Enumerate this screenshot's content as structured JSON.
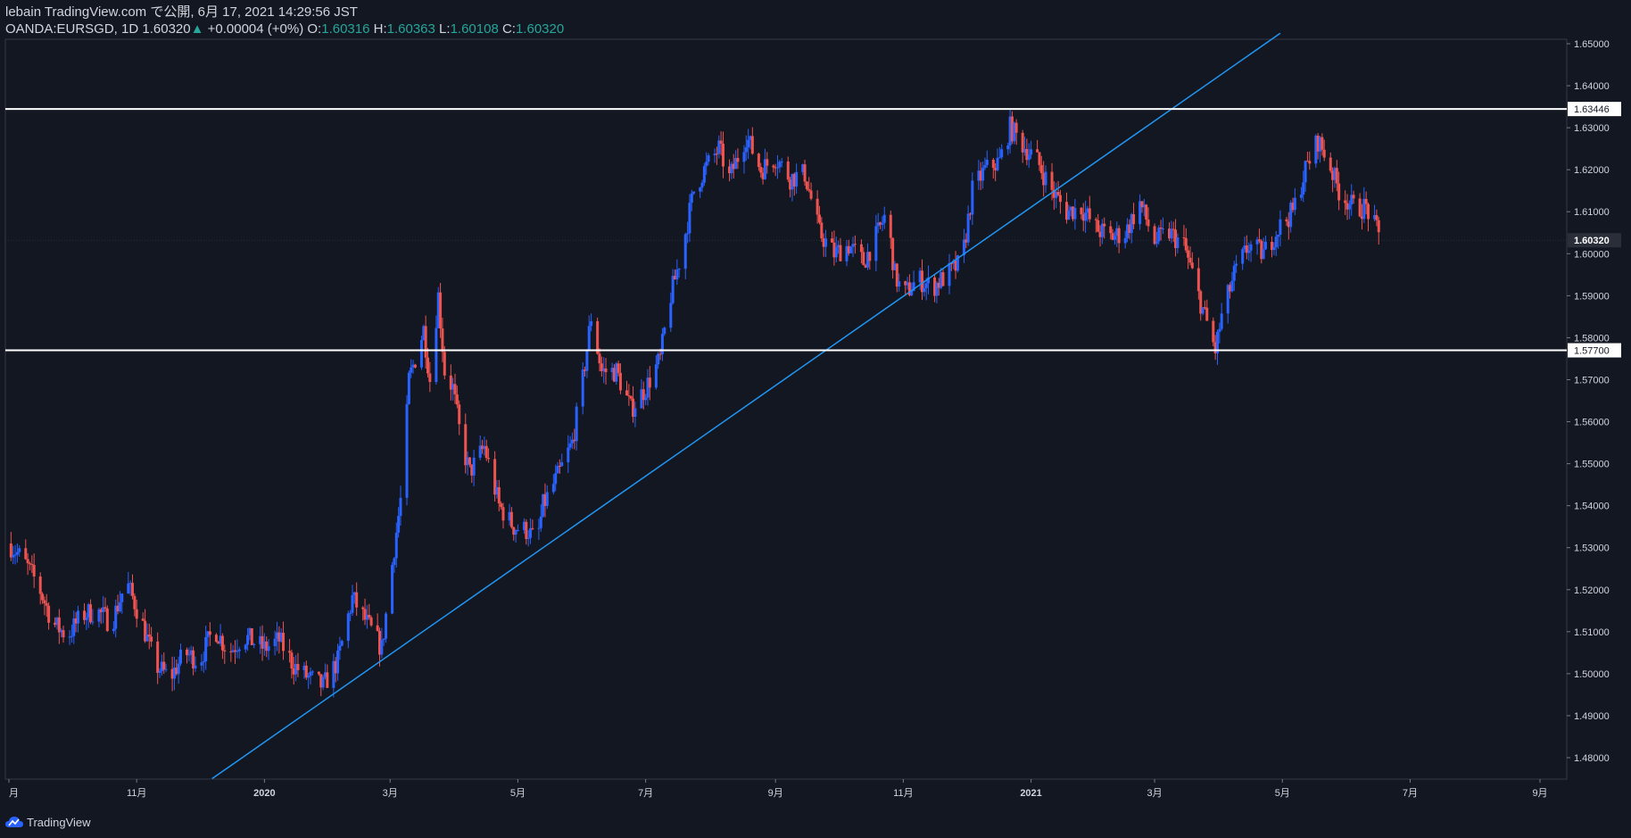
{
  "header": {
    "publish_line": "lebain TradingView.com で公開, 6月 17, 2021 14:29:56 JST",
    "symbol": "OANDA:EURSGD, 1D",
    "last": "1.60320",
    "change_arrow": "▲",
    "change": "+0.00004 (+0%)",
    "open_label": "O:",
    "open": "1.60316",
    "high_label": "H:",
    "high": "1.60363",
    "low_label": "L:",
    "low": "1.60108",
    "close_label": "C:",
    "close": "1.60320"
  },
  "footer": {
    "brand": "TradingView"
  },
  "colors": {
    "background": "#131722",
    "up": "#2962ff",
    "down": "#ef5350",
    "trendline": "#2196f3",
    "level": "#ffffff",
    "axis_text": "#d1d4dc",
    "teal": "#26a69a"
  },
  "chart_data": {
    "type": "candlestick",
    "symbol": "OANDA:EURSGD",
    "interval": "1D",
    "ylim": [
      1.475,
      1.6525
    ],
    "y_ticks": [
      "1.48000",
      "1.49000",
      "1.50000",
      "1.51000",
      "1.52000",
      "1.53000",
      "1.54000",
      "1.55000",
      "1.56000",
      "1.57000",
      "1.58000",
      "1.59000",
      "1.60000",
      "1.61000",
      "1.62000",
      "1.63000",
      "1.64000",
      "1.65000"
    ],
    "x_ticks": [
      {
        "label": "月",
        "date": "2019-09-01"
      },
      {
        "label": "11月",
        "date": "2019-11-01"
      },
      {
        "label": "2020",
        "date": "2020-01-01"
      },
      {
        "label": "3月",
        "date": "2020-03-01"
      },
      {
        "label": "5月",
        "date": "2020-05-01"
      },
      {
        "label": "7月",
        "date": "2020-07-01"
      },
      {
        "label": "9月",
        "date": "2020-09-01"
      },
      {
        "label": "11月",
        "date": "2020-11-01"
      },
      {
        "label": "2021",
        "date": "2021-01-01"
      },
      {
        "label": "3月",
        "date": "2021-03-01"
      },
      {
        "label": "5月",
        "date": "2021-05-01"
      },
      {
        "label": "7月",
        "date": "2021-07-01"
      },
      {
        "label": "9月",
        "date": "2021-09-01"
      }
    ],
    "horizontal_levels": [
      {
        "value": 1.63446,
        "label": "1.63446"
      },
      {
        "value": 1.577,
        "label": "1.57700"
      }
    ],
    "last_price": {
      "value": 1.6032,
      "label": "1.60320"
    },
    "trendline": {
      "from": {
        "date": "2019-12-07",
        "price": 1.475
      },
      "to": {
        "date": "2021-04-30",
        "price": 1.6525
      }
    },
    "closes": [
      [
        "2019-09-01",
        1.531
      ],
      [
        "2019-09-08",
        1.527
      ],
      [
        "2019-09-15",
        1.521
      ],
      [
        "2019-09-22",
        1.512
      ],
      [
        "2019-09-29",
        1.509
      ],
      [
        "2019-10-06",
        1.514
      ],
      [
        "2019-10-13",
        1.515
      ],
      [
        "2019-10-20",
        1.512
      ],
      [
        "2019-10-27",
        1.522
      ],
      [
        "2019-11-03",
        1.513
      ],
      [
        "2019-11-10",
        1.502
      ],
      [
        "2019-11-17",
        1.499
      ],
      [
        "2019-11-24",
        1.505
      ],
      [
        "2019-12-01",
        1.503
      ],
      [
        "2019-12-08",
        1.511
      ],
      [
        "2019-12-15",
        1.505
      ],
      [
        "2019-12-22",
        1.509
      ],
      [
        "2020-01-01",
        1.506
      ],
      [
        "2020-01-08",
        1.508
      ],
      [
        "2020-01-15",
        1.502
      ],
      [
        "2020-01-22",
        1.499
      ],
      [
        "2020-01-29",
        1.497
      ],
      [
        "2020-02-05",
        1.503
      ],
      [
        "2020-02-12",
        1.518
      ],
      [
        "2020-02-19",
        1.512
      ],
      [
        "2020-02-26",
        1.506
      ],
      [
        "2020-03-03",
        1.53
      ],
      [
        "2020-03-07",
        1.545
      ],
      [
        "2020-03-10",
        1.57
      ],
      [
        "2020-03-13",
        1.575
      ],
      [
        "2020-03-17",
        1.582
      ],
      [
        "2020-03-20",
        1.57
      ],
      [
        "2020-03-24",
        1.59
      ],
      [
        "2020-03-27",
        1.572
      ],
      [
        "2020-03-31",
        1.568
      ],
      [
        "2020-04-04",
        1.555
      ],
      [
        "2020-04-08",
        1.548
      ],
      [
        "2020-04-15",
        1.554
      ],
      [
        "2020-04-22",
        1.54
      ],
      [
        "2020-04-29",
        1.535
      ],
      [
        "2020-05-06",
        1.534
      ],
      [
        "2020-05-10",
        1.531
      ],
      [
        "2020-05-13",
        1.54
      ],
      [
        "2020-05-20",
        1.547
      ],
      [
        "2020-05-27",
        1.555
      ],
      [
        "2020-06-01",
        1.57
      ],
      [
        "2020-06-05",
        1.585
      ],
      [
        "2020-06-10",
        1.572
      ],
      [
        "2020-06-17",
        1.572
      ],
      [
        "2020-06-24",
        1.563
      ],
      [
        "2020-07-01",
        1.568
      ],
      [
        "2020-07-08",
        1.575
      ],
      [
        "2020-07-12",
        1.588
      ],
      [
        "2020-07-18",
        1.6
      ],
      [
        "2020-07-24",
        1.615
      ],
      [
        "2020-07-29",
        1.62
      ],
      [
        "2020-08-05",
        1.625
      ],
      [
        "2020-08-10",
        1.618
      ],
      [
        "2020-08-18",
        1.628
      ],
      [
        "2020-08-25",
        1.62
      ],
      [
        "2020-09-01",
        1.623
      ],
      [
        "2020-09-08",
        1.618
      ],
      [
        "2020-09-15",
        1.619
      ],
      [
        "2020-09-22",
        1.605
      ],
      [
        "2020-09-29",
        1.6
      ],
      [
        "2020-10-06",
        1.602
      ],
      [
        "2020-10-13",
        1.598
      ],
      [
        "2020-10-20",
        1.605
      ],
      [
        "2020-10-24",
        1.61
      ],
      [
        "2020-10-28",
        1.595
      ],
      [
        "2020-11-01",
        1.59
      ],
      [
        "2020-11-08",
        1.594
      ],
      [
        "2020-11-15",
        1.592
      ],
      [
        "2020-11-22",
        1.595
      ],
      [
        "2020-11-29",
        1.598
      ],
      [
        "2020-12-04",
        1.615
      ],
      [
        "2020-12-10",
        1.62
      ],
      [
        "2020-12-17",
        1.622
      ],
      [
        "2020-12-22",
        1.63
      ],
      [
        "2020-12-28",
        1.626
      ],
      [
        "2021-01-04",
        1.622
      ],
      [
        "2021-01-11",
        1.615
      ],
      [
        "2021-01-18",
        1.61
      ],
      [
        "2021-01-25",
        1.611
      ],
      [
        "2021-02-01",
        1.606
      ],
      [
        "2021-02-08",
        1.604
      ],
      [
        "2021-02-15",
        1.605
      ],
      [
        "2021-02-22",
        1.612
      ],
      [
        "2021-03-01",
        1.603
      ],
      [
        "2021-03-08",
        1.605
      ],
      [
        "2021-03-15",
        1.602
      ],
      [
        "2021-03-22",
        1.59
      ],
      [
        "2021-03-30",
        1.577
      ],
      [
        "2021-04-02",
        1.585
      ],
      [
        "2021-04-08",
        1.595
      ],
      [
        "2021-04-15",
        1.602
      ],
      [
        "2021-04-22",
        1.6
      ],
      [
        "2021-04-29",
        1.606
      ],
      [
        "2021-05-06",
        1.61
      ],
      [
        "2021-05-12",
        1.62
      ],
      [
        "2021-05-18",
        1.627
      ],
      [
        "2021-05-23",
        1.622
      ],
      [
        "2021-05-28",
        1.615
      ],
      [
        "2021-06-04",
        1.611
      ],
      [
        "2021-06-10",
        1.611
      ],
      [
        "2021-06-17",
        1.6032
      ]
    ]
  }
}
